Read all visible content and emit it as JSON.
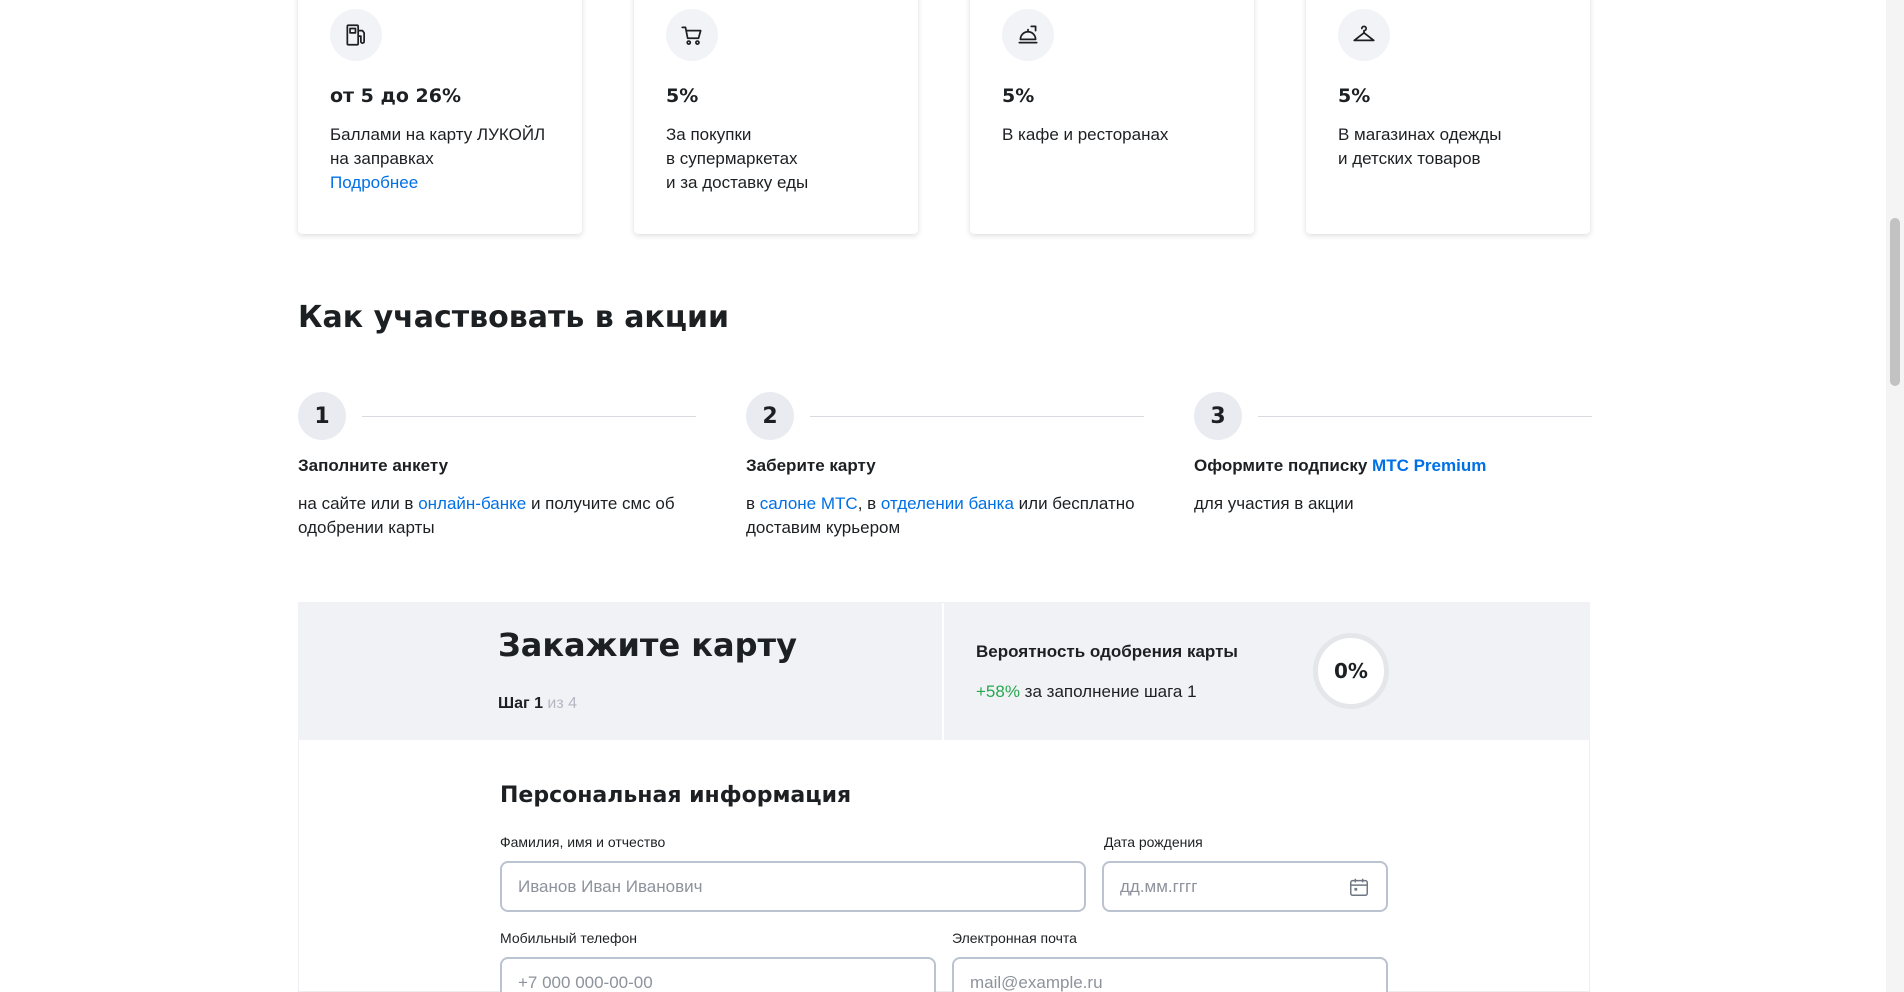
{
  "cashback_cards": [
    {
      "icon": "fuel-pump-icon",
      "value": "от 5 до 26%",
      "lines": [
        "Баллами на карту ЛУКОЙЛ",
        "на заправках"
      ],
      "link": "Подробнее"
    },
    {
      "icon": "shopping-cart-icon",
      "value": "5%",
      "lines": [
        "За покупки",
        "в супермаркетах",
        "и за доставку еды"
      ]
    },
    {
      "icon": "restaurant-icon",
      "value": "5%",
      "lines": [
        "В кафе и ресторанах"
      ]
    },
    {
      "icon": "clothes-hanger-icon",
      "value": "5%",
      "lines": [
        "В магазинах одежды",
        "и детских товаров"
      ]
    }
  ],
  "how_to": {
    "title": "Как участвовать в акции",
    "steps": [
      {
        "number": "1",
        "title": "Заполните анкету",
        "desc": {
          "t1": "на сайте или в ",
          "link1": "онлайн-банке",
          "t2": " и получите смс об одобрении карты"
        }
      },
      {
        "number": "2",
        "title": "Заберите карту",
        "desc": {
          "t1": "в ",
          "link1": "салоне МТС",
          "t2": ", в ",
          "link2": "отделении банка",
          "t3": " или бесплатно доставим курьером"
        }
      },
      {
        "number": "3",
        "title": "Оформите подписку ",
        "title_link": "МТС Premium",
        "desc": {
          "t1": "для участия в акции"
        }
      }
    ]
  },
  "order": {
    "title": "Закажите карту",
    "step_current": "Шаг 1",
    "step_total": " из 4",
    "approval_label": "Вероятность одобрения карты",
    "approval_gain": "+58%",
    "approval_gain_text": " за заполнение шага 1",
    "approval_value": "0%",
    "approval_fraction": 0
  },
  "form": {
    "title": "Персональная информация",
    "fullname": {
      "label": "Фамилия, имя и отчество",
      "placeholder": "Иванов Иван Иванович",
      "value": ""
    },
    "birthdate": {
      "label": "Дата рождения",
      "placeholder": "дд.мм.гггг",
      "value": "",
      "icon": "calendar-icon"
    },
    "phone": {
      "label": "Мобильный телефон",
      "placeholder": "+7 000 000-00-00",
      "value": ""
    },
    "email": {
      "label": "Электронная почта",
      "placeholder": "mail@example.ru",
      "value": ""
    }
  },
  "colors": {
    "accent": "#0070e5",
    "positive": "#26a850",
    "panel_bg": "#f1f2f5",
    "muted": "#b3b8c2"
  }
}
